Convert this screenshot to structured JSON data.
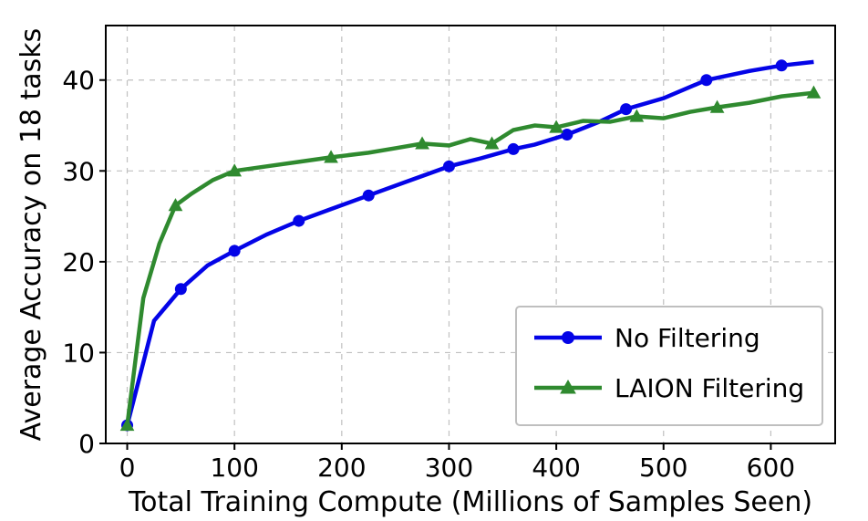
{
  "chart_data": {
    "type": "line",
    "xlabel": "Total Training Compute (Millions of Samples Seen)",
    "ylabel": "Average Accuracy on 18 tasks",
    "title": "",
    "xlim": [
      -20,
      660
    ],
    "ylim": [
      -2,
      44
    ],
    "xticks": [
      0,
      100,
      200,
      300,
      400,
      500,
      600
    ],
    "yticks": [
      0,
      10,
      20,
      30,
      40
    ],
    "grid": true,
    "legend_position": "lower-right",
    "series": [
      {
        "name": "No Filtering",
        "color": "#0404e7",
        "marker": "circle",
        "x": [
          0,
          25,
          50,
          75,
          100,
          130,
          160,
          190,
          225,
          260,
          300,
          330,
          360,
          380,
          410,
          440,
          465,
          500,
          540,
          580,
          610,
          640
        ],
        "values": [
          0,
          11.5,
          15.0,
          17.6,
          19.2,
          21.0,
          22.5,
          23.8,
          25.3,
          26.8,
          28.5,
          29.4,
          30.4,
          30.9,
          32.0,
          33.4,
          34.8,
          36.0,
          38.0,
          39.0,
          39.6,
          40.0
        ]
      },
      {
        "name": "LAION Filtering",
        "color": "#2f8a2f",
        "marker": "triangle",
        "x": [
          0,
          15,
          30,
          45,
          60,
          80,
          100,
          130,
          160,
          190,
          225,
          250,
          275,
          300,
          320,
          340,
          360,
          380,
          400,
          425,
          450,
          475,
          500,
          525,
          550,
          580,
          610,
          640
        ],
        "values": [
          0,
          14.0,
          20.0,
          24.2,
          25.5,
          27.0,
          28.0,
          28.5,
          29.0,
          29.5,
          30.0,
          30.5,
          31.0,
          30.8,
          31.5,
          31.0,
          32.5,
          33.0,
          32.8,
          33.5,
          33.4,
          34.0,
          33.8,
          34.5,
          35.0,
          35.5,
          36.2,
          36.6
        ]
      }
    ]
  },
  "legend": {
    "items": [
      {
        "label": "No Filtering"
      },
      {
        "label": "LAION Filtering"
      }
    ]
  },
  "axes": {
    "xlabel": "Total Training Compute (Millions of Samples Seen)",
    "ylabel": "Average Accuracy on 18 tasks",
    "xtick_labels": [
      "0",
      "100",
      "200",
      "300",
      "400",
      "500",
      "600"
    ],
    "ytick_labels": [
      "0",
      "10",
      "20",
      "30",
      "40"
    ]
  }
}
